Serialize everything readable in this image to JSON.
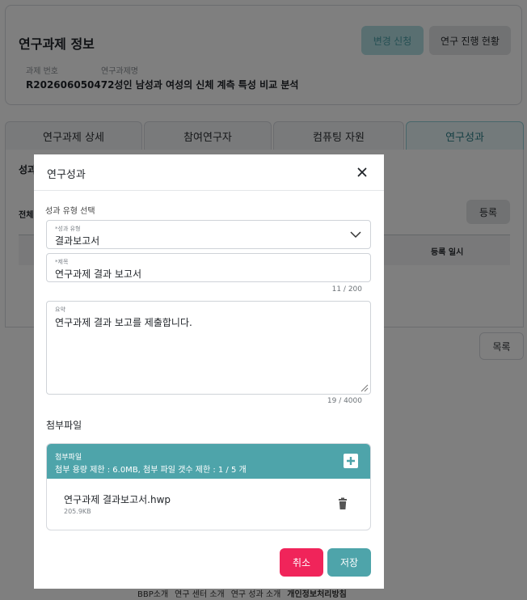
{
  "page": {
    "title": "연구과제 정보",
    "buttons": {
      "change_request": "변경 신청",
      "progress_status": "연구 진행 현황"
    },
    "project_no_label": "과제 번호",
    "project_name_label": "연구과제명",
    "project_no_and_name": "R202606050472성인 남성과 여성의 신체 계측 특성 비교 분석"
  },
  "tabs": [
    {
      "label": "연구과제 상세"
    },
    {
      "label": "참여연구자"
    },
    {
      "label": "컴퓨팅 자원"
    },
    {
      "label": "연구성과",
      "active": true
    }
  ],
  "result_section": {
    "title_partial": "성과",
    "total_partial": "전체",
    "register_label": "등록",
    "date_column": "등록 일시",
    "list_label": "목록"
  },
  "footer": {
    "links": [
      "BBP소개",
      "연구 센터 소개",
      "연구 성과 소개",
      "개인정보처리방침"
    ]
  },
  "modal": {
    "title": "연구성과",
    "section_label": "성과 유형 선택",
    "type_field": {
      "label": "*성과 유형",
      "value": "결과보고서"
    },
    "title_field": {
      "label": "*제목",
      "value": "연구과제 결과 보고서",
      "count": "11 / 200"
    },
    "summary_field": {
      "label": "요약",
      "value": "연구과제 결과 보고를 제출합니다.",
      "count": "19 / 4000"
    },
    "attachment": {
      "section_title": "첨부파일",
      "header_label": "첨부파일",
      "limit_text": "첨부 용량 제한 : 6.0MB, 첨부 파일 갯수 제한 : 1 / 5 개",
      "files": [
        {
          "name": "연구과제 결과보고서.hwp",
          "size": "205.9KB"
        }
      ]
    },
    "cancel_label": "취소",
    "save_label": "저장"
  },
  "colors": {
    "accent": "#4ea4aa",
    "danger": "#f0245a",
    "overlay": "rgba(0,0,0,0.5)"
  }
}
